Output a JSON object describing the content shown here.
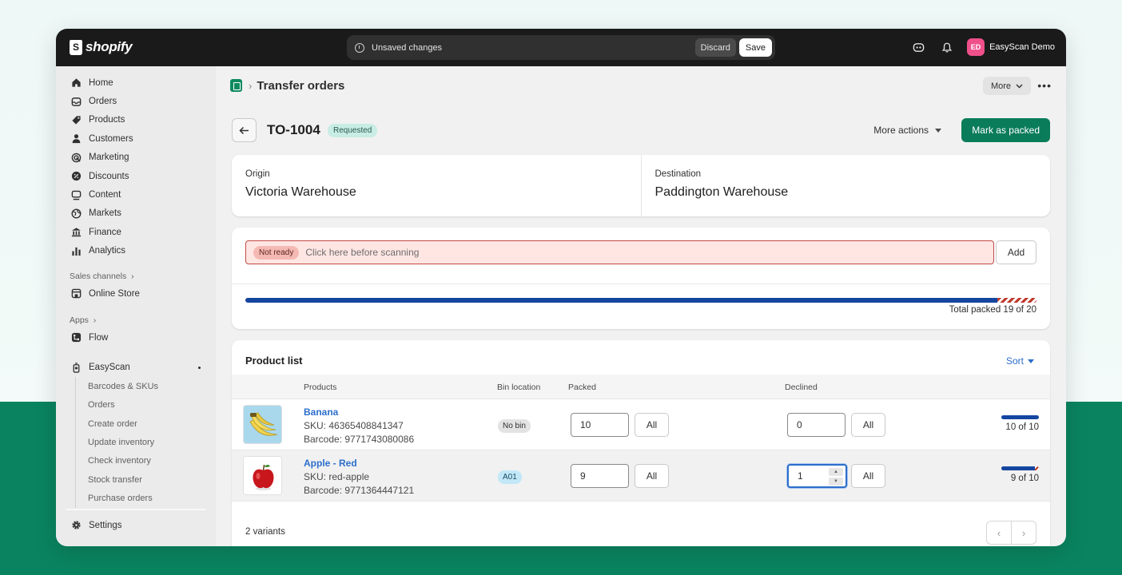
{
  "topbar": {
    "brand": "shopify",
    "unsaved_message": "Unsaved changes",
    "discard_label": "Discard",
    "save_label": "Save",
    "avatar_initials": "ED",
    "store_name": "EasyScan Demo"
  },
  "sidebar": {
    "main_items": [
      {
        "label": "Home",
        "icon": "home-icon"
      },
      {
        "label": "Orders",
        "icon": "inbox-icon"
      },
      {
        "label": "Products",
        "icon": "tag-icon"
      },
      {
        "label": "Customers",
        "icon": "person-icon"
      },
      {
        "label": "Marketing",
        "icon": "target-icon"
      },
      {
        "label": "Discounts",
        "icon": "discount-icon"
      },
      {
        "label": "Content",
        "icon": "content-icon"
      },
      {
        "label": "Markets",
        "icon": "globe-icon"
      },
      {
        "label": "Finance",
        "icon": "bank-icon"
      },
      {
        "label": "Analytics",
        "icon": "chart-bar-icon"
      }
    ],
    "sales_channels_label": "Sales channels",
    "online_store": "Online Store",
    "apps_label": "Apps",
    "flow": "Flow",
    "easyscan": "EasyScan",
    "easyscan_sub": [
      "Barcodes & SKUs",
      "Orders",
      "Create order",
      "Update inventory",
      "Check inventory",
      "Stock transfer",
      "Purchase orders"
    ],
    "settings": "Settings"
  },
  "page": {
    "title": "Transfer orders",
    "more_label": "More",
    "order_id": "TO-1004",
    "status": "Requested",
    "more_actions": "More actions",
    "mark_packed": "Mark as packed"
  },
  "origin": {
    "label": "Origin",
    "value": "Victoria Warehouse"
  },
  "destination": {
    "label": "Destination",
    "value": "Paddington Warehouse"
  },
  "scan": {
    "badge": "Not ready",
    "placeholder": "Click here before scanning",
    "add_label": "Add",
    "packed": 19,
    "total": 20,
    "total_text": "Total packed 19 of 20"
  },
  "product_list": {
    "title": "Product list",
    "sort_label": "Sort",
    "headers": {
      "products": "Products",
      "bin": "Bin location",
      "packed": "Packed",
      "declined": "Declined"
    },
    "rows": [
      {
        "name": "Banana",
        "sku": "SKU: 46365408841347",
        "barcode": "Barcode: 9771743080086",
        "bin": "No bin",
        "packed": "10",
        "declined": "0",
        "all": "All",
        "count": "10 of 10",
        "fraction": 1.0
      },
      {
        "name": "Apple - Red",
        "sku": "SKU: red-apple",
        "barcode": "Barcode: 9771364447121",
        "bin": "A01",
        "packed": "9",
        "declined": "1",
        "all": "All",
        "count": "9 of 10",
        "fraction": 0.9
      }
    ],
    "footer": "2 variants"
  },
  "colors": {
    "accent": "#0a7c5a",
    "progress": "#1446a0",
    "error": "#c24a44",
    "link": "#2c6ecb"
  }
}
